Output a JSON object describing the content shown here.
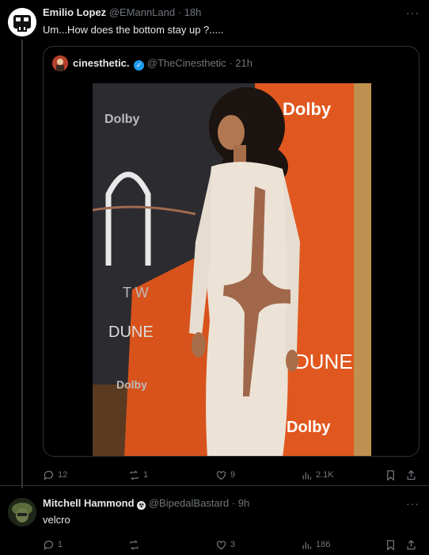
{
  "main_post": {
    "display_name": "Emilio Lopez",
    "handle": "@EMannLand",
    "separator": "·",
    "time": "18h",
    "text": "Um...How does the bottom stay up ?.....",
    "more": "···"
  },
  "quoted_post": {
    "display_name": "cinesthetic.",
    "handle": "@TheCinesthetic",
    "separator": "·",
    "time": "21h",
    "photo_texts": {
      "dolby_1": "Dolby",
      "dolby_2": "Dolby",
      "dolby_3": "Dolby",
      "dolby_4": "Dolby",
      "dune_1": "DUNE",
      "dune_2": "DUNE",
      "tw": "T W"
    }
  },
  "main_actions": {
    "replies": "12",
    "reposts": "1",
    "likes": "9",
    "views": "2.1K"
  },
  "reply_post": {
    "display_name": "Mitchell Hammond",
    "badge": "☢",
    "handle": "@BipedalBastard",
    "separator": "·",
    "time": "9h",
    "text": "velcro",
    "more": "···"
  },
  "reply_actions": {
    "replies": "1",
    "reposts": "",
    "likes": "3",
    "views": "186"
  },
  "colors": {
    "background": "#000000",
    "text": "#e7e9ea",
    "muted": "#71767b",
    "border": "#2f3336",
    "verified": "#1d9bf0",
    "orange_backdrop": "#e0581f"
  }
}
